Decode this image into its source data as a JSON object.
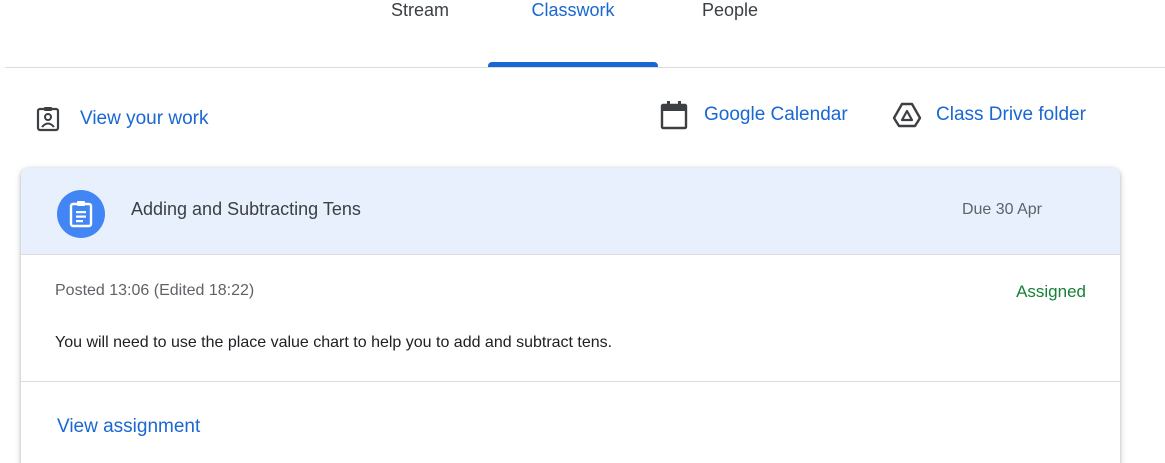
{
  "tabs": [
    {
      "label": "Stream",
      "active": false
    },
    {
      "label": "Classwork",
      "active": true
    },
    {
      "label": "People",
      "active": false
    }
  ],
  "toolbar": {
    "view_work": {
      "label": "View your work",
      "icon": "assignment-ind-icon"
    },
    "calendar": {
      "label": "Google Calendar",
      "icon": "calendar-icon"
    },
    "drive": {
      "label": "Class Drive folder",
      "icon": "drive-icon"
    }
  },
  "assignment": {
    "icon": "assignment-icon",
    "title": "Adding and Subtracting Tens",
    "due": "Due 30 Apr",
    "posted": "Posted 13:06 (Edited 18:22)",
    "status": "Assigned",
    "description": "You will need to use the place value chart to help you to add and subtract tens.",
    "view_link": "View assignment"
  },
  "colors": {
    "accent": "#1967d2",
    "header_bg": "#e8f0fe",
    "icon_circle": "#4285f4",
    "status_green": "#188038"
  }
}
